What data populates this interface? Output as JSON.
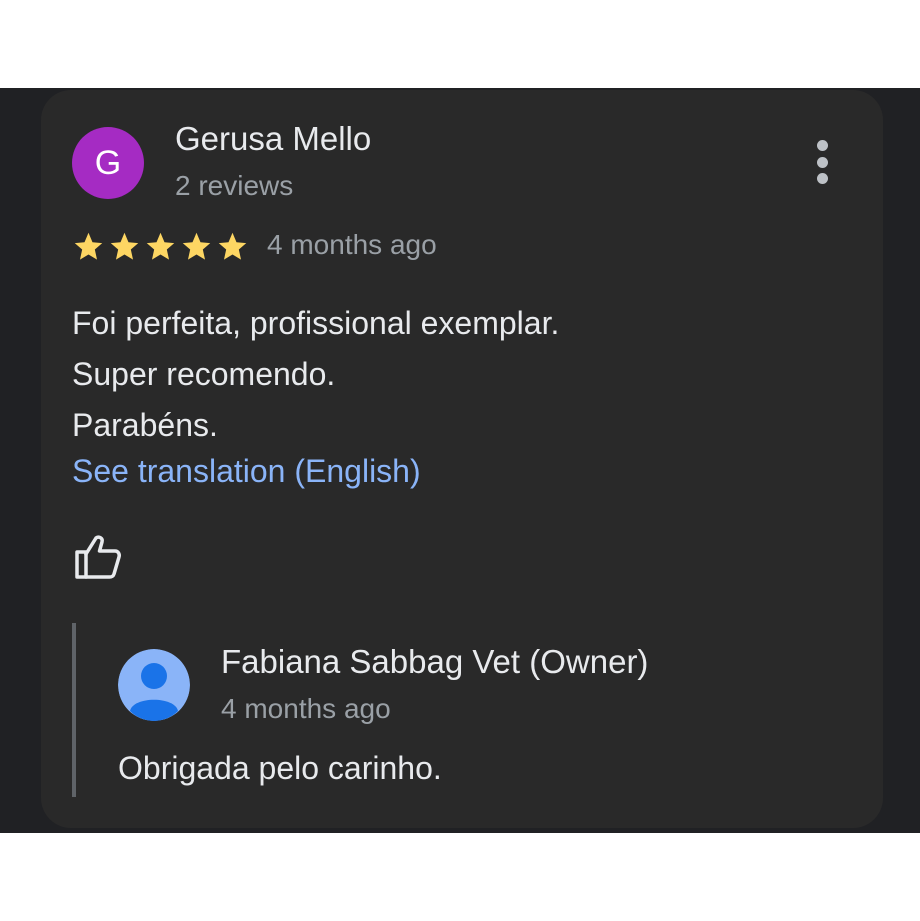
{
  "review": {
    "author": {
      "initial": "G",
      "name": "Gerusa Mello",
      "meta": "2 reviews",
      "avatar_color": "#a52bc3"
    },
    "rating": 5,
    "rating_max": 5,
    "star_color": "#fdd663",
    "time": "4 months ago",
    "text_lines": [
      "Foi perfeita, profissional exemplar.",
      "Super recomendo.",
      "Parabéns."
    ],
    "translate_label": "See translation (English)",
    "more_icon": "more-vert-icon",
    "like_icon": "thumb-up-icon"
  },
  "owner_reply": {
    "name": "Fabiana Sabbag Vet (Owner)",
    "time": "4 months ago",
    "text": "Obrigada pelo carinho.",
    "avatar_icon": "person-icon",
    "avatar_color": "#8ab4f8"
  },
  "colors": {
    "background": "#202124",
    "card": "#292929",
    "primary_text": "#e8eaed",
    "secondary_text": "#9aa0a6",
    "link": "#8ab4f8"
  }
}
